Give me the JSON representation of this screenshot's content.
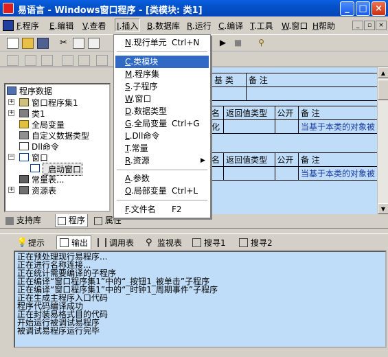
{
  "window": {
    "title": "易语言 - Windows窗口程序 - [类模块: 类1]",
    "min_label": "_",
    "max_label": "□",
    "close_label": "×"
  },
  "menubar": {
    "items": [
      {
        "key": "F",
        "label": ".程序"
      },
      {
        "key": "E",
        "label": ".编辑"
      },
      {
        "key": "V",
        "label": ".查看"
      },
      {
        "key": "I",
        "label": ".插入"
      },
      {
        "key": "B",
        "label": ".数据库"
      },
      {
        "key": "R",
        "label": ".运行"
      },
      {
        "key": "C",
        "label": ".编译"
      },
      {
        "key": "T",
        "label": ".工具"
      },
      {
        "key": "W",
        "label": ".窗口"
      },
      {
        "key": "H",
        "label": "帮助"
      }
    ],
    "mdi_buttons": [
      "_",
      "▫",
      "×"
    ]
  },
  "insert_menu": {
    "items": [
      {
        "key": "N",
        "label": ".现行单元",
        "shortcut": "Ctrl+N"
      },
      {
        "key": "C",
        "label": ".类模块",
        "shortcut": "",
        "selected": true
      },
      {
        "key": "M",
        "label": ".程序集",
        "shortcut": ""
      },
      {
        "key": "S",
        "label": ".子程序",
        "shortcut": ""
      },
      {
        "key": "W",
        "label": ".窗口",
        "shortcut": ""
      },
      {
        "key": "D",
        "label": ".数据类型",
        "shortcut": ""
      },
      {
        "key": "G",
        "label": ".全局变量",
        "shortcut": "Ctrl+G"
      },
      {
        "key": "L",
        "label": ".Dll命令",
        "shortcut": ""
      },
      {
        "key": "T",
        "label": ".常量",
        "shortcut": ""
      },
      {
        "key": "R",
        "label": ".资源",
        "shortcut": "▶"
      },
      {
        "key": "A",
        "label": ".参数",
        "shortcut": ""
      },
      {
        "key": "O",
        "label": ".局部变量",
        "shortcut": "Ctrl+L"
      },
      {
        "key": "F",
        "label": ".文件名",
        "shortcut": "F2"
      }
    ]
  },
  "tree": {
    "root": "程序数据",
    "items": [
      {
        "label": "窗口程序集1"
      },
      {
        "label": "类1"
      },
      {
        "label": "全局变量"
      },
      {
        "label": "自定义数据类型"
      },
      {
        "label": "Dll命令"
      },
      {
        "label": "窗口"
      },
      {
        "label": "_启动窗口"
      },
      {
        "label": "常量表..."
      },
      {
        "label": "资源表"
      }
    ]
  },
  "left_tabs": [
    "支持库",
    "程序",
    "属性"
  ],
  "editor": {
    "class_table": {
      "headers": [
        "基 类",
        "备 注"
      ]
    },
    "method_table_1": {
      "headers": [
        "名",
        "返回值类型",
        "公开",
        "备 注"
      ],
      "row": [
        "化",
        "",
        "",
        "当基于本类的对象被"
      ]
    },
    "method_table_2": {
      "headers": [
        "名",
        "返回值类型",
        "公开",
        "备 注"
      ],
      "row": [
        "",
        "",
        "",
        "当基于本类的对象被"
      ]
    }
  },
  "bottom_tabs": [
    "提示",
    "输出",
    "调用表",
    "监视表",
    "搜寻1",
    "搜寻2"
  ],
  "output": {
    "lines": [
      "正在预处理现行易程序...",
      "正在进行名称连接...",
      "正在统计需要编译的子程序",
      "正在编译“窗口程序集1”中的“_按钮1_被单击”子程序",
      "正在编译“窗口程序集1”中的“_时钟1_周期事件”子程序",
      "正在生成主程序入口代码",
      "程序代码编译成功",
      "正在封装易格式目的代码",
      "开始运行被调试易程序",
      "被调试易程序运行完毕"
    ]
  },
  "colors": {
    "titlebar": "#0452c8",
    "editor_bg": "#bfdcf8",
    "selected_menu": "#316ac5",
    "remark_text": "#1a3aa0"
  }
}
